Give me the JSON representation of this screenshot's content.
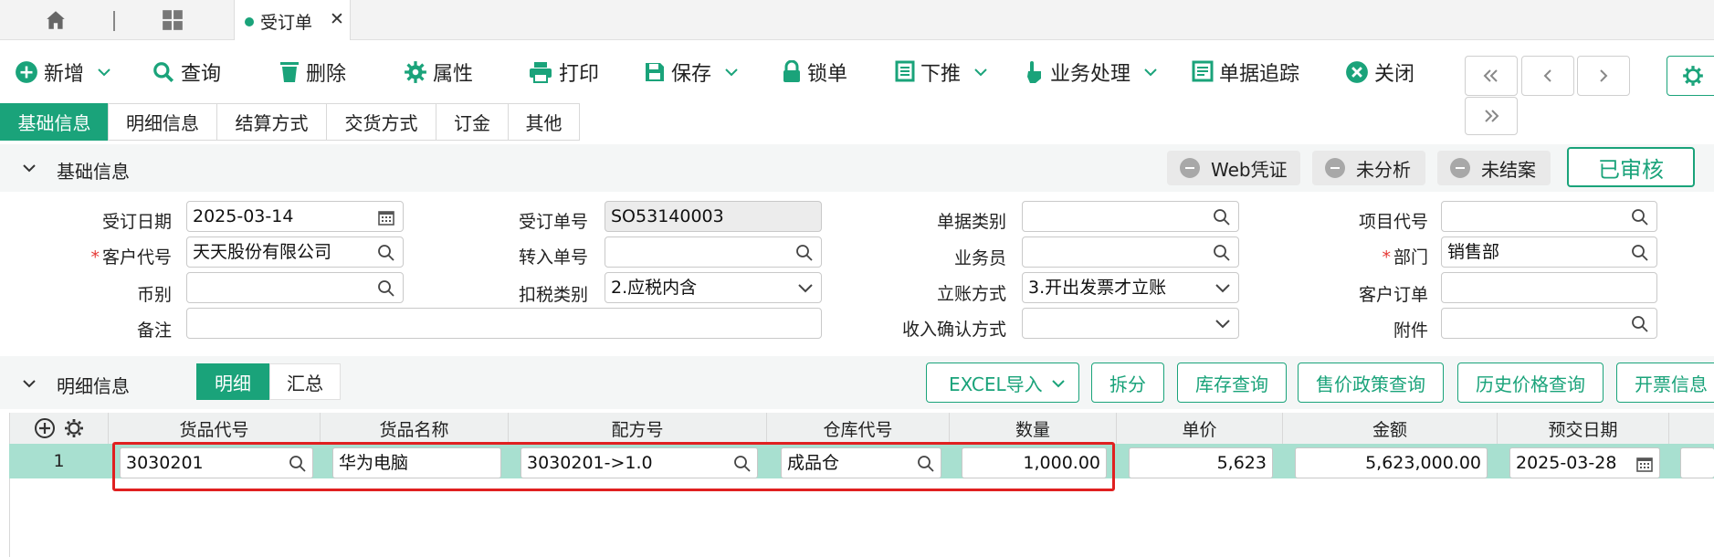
{
  "tabs": {
    "order_tab_label": "受订单"
  },
  "toolbar": {
    "add": "新增",
    "query": "查询",
    "delete": "删除",
    "attributes": "属性",
    "print": "打印",
    "save": "保存",
    "lock": "锁单",
    "push_down": "下推",
    "business": "业务处理",
    "trace": "单据追踪",
    "close": "关闭"
  },
  "subtabs": [
    "基础信息",
    "明细信息",
    "结算方式",
    "交货方式",
    "订金",
    "其他"
  ],
  "basic": {
    "title": "基础信息",
    "status": {
      "web_voucher": "Web凭证",
      "unanalyzed": "未分析",
      "unclosed": "未结案",
      "approved": "已审核"
    },
    "fields": {
      "order_date_label": "受订日期",
      "order_date": "2025-03-14",
      "customer_code_label": "客户代号",
      "customer_code": "天天股份有限公司",
      "currency_label": "币别",
      "currency": "",
      "remark_label": "备注",
      "remark": "",
      "order_no_label": "受订单号",
      "order_no": "SO53140003",
      "transfer_no_label": "转入单号",
      "transfer_no": "",
      "tax_type_label": "扣税类别",
      "tax_type": "2.应税内含",
      "doc_type_label": "单据类别",
      "doc_type": "",
      "salesman_label": "业务员",
      "salesman": "",
      "account_method_label": "立账方式",
      "account_method": "3.开出发票才立账",
      "income_confirm_label": "收入确认方式",
      "income_confirm": "",
      "project_code_label": "项目代号",
      "project_code": "",
      "department_label": "部门",
      "department": "销售部",
      "customer_order_label": "客户订单",
      "customer_order": "",
      "attachment_label": "附件",
      "attachment": ""
    }
  },
  "detail": {
    "title": "明细信息",
    "seg_detail": "明细",
    "seg_summary": "汇总",
    "buttons": {
      "excel": "EXCEL导入",
      "split": "拆分",
      "stock": "库存查询",
      "price_policy": "售价政策查询",
      "history": "历史价格查询",
      "invoice": "开票信息"
    },
    "columns": [
      "货品代号",
      "货品名称",
      "配方号",
      "仓库代号",
      "数量",
      "单价",
      "金额",
      "预交日期"
    ],
    "rows": [
      {
        "no": "1",
        "code": "3030201",
        "name": "华为电脑",
        "formula": "3030201->1.0",
        "warehouse": "成品仓",
        "qty": "1,000.00",
        "price": "5,623",
        "amount": "5,623,000.00",
        "date": "2025-03-28"
      }
    ]
  },
  "colors": {
    "accent": "#1aa37a",
    "highlight_row": "#a8e0d0",
    "required": "#e53935",
    "annotation_box": "#e02020"
  }
}
